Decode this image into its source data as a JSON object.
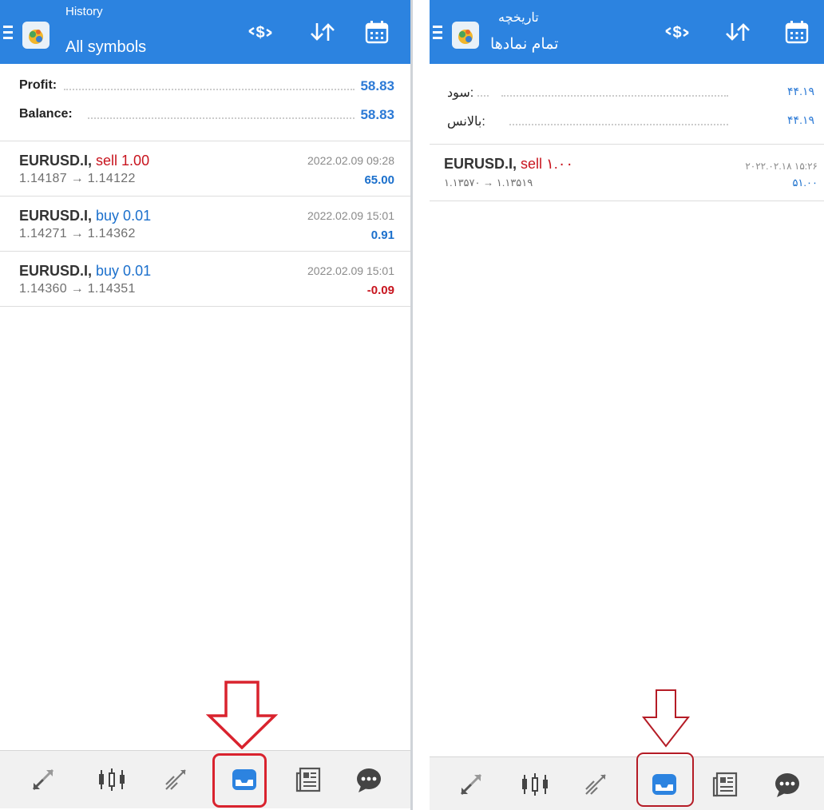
{
  "left": {
    "header": {
      "subtitle": "History",
      "title": "All symbols"
    },
    "summary": {
      "profit_label": "Profit:",
      "profit_value": "58.83",
      "balance_label": "Balance:",
      "balance_value": "58.83"
    },
    "trades": [
      {
        "symbol": "EURUSD.I,",
        "side": "sell 1.00",
        "side_type": "sell",
        "prices": "1.14187 → 1.14122",
        "date": "2022.02.09 09:28",
        "pl": "65.00"
      },
      {
        "symbol": "EURUSD.I,",
        "side": "buy 0.01",
        "side_type": "buy",
        "prices": "1.14271 → 1.14362",
        "date": "2022.02.09 15:01",
        "pl": "0.91"
      },
      {
        "symbol": "EURUSD.I,",
        "side": "buy 0.01",
        "side_type": "buy",
        "prices": "1.14360 → 1.14351",
        "date": "2022.02.09 15:01",
        "pl": "-0.09"
      }
    ]
  },
  "right": {
    "header": {
      "subtitle": "تاریخچه",
      "title": "تمام نمادها"
    },
    "summary": {
      "profit_label": "سود:",
      "profit_value": "۴۴.۱۹",
      "balance_label": "بالانس:",
      "balance_value": "۴۴.۱۹"
    },
    "trades": [
      {
        "symbol": "EURUSD.I,",
        "side": "sell ۱.۰۰",
        "side_type": "sell",
        "prices": "۱.۱۳۵۷۰ → ۱.۱۳۵۱۹",
        "date": "۲۰۲۲.۰۲.۱۸ ۱۵:۲۶",
        "pl": "۵۱.۰۰"
      }
    ]
  },
  "toolbar_icons": [
    "currency-exchange-icon",
    "sort-icon",
    "calendar-icon"
  ],
  "bottom_nav": [
    "quotes",
    "chart",
    "trade",
    "history",
    "news",
    "chat"
  ],
  "active_tab": "history",
  "colors": {
    "header_blue": "#2c83e0",
    "value_blue": "#2c7ad6",
    "sell_red": "#c8141e",
    "buy_blue": "#1a6fcc",
    "annotation_red": "#d9232e"
  }
}
